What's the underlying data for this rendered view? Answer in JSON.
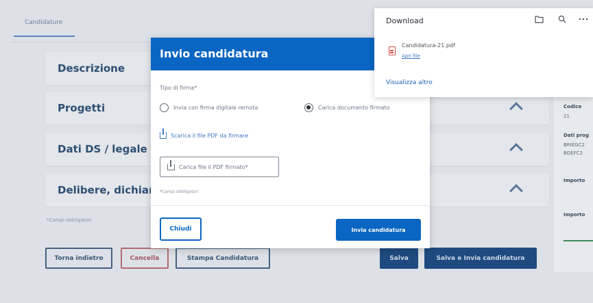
{
  "page": {
    "tab": "Candidature",
    "accordions": [
      {
        "title": "Descrizione"
      },
      {
        "title": "Progetti"
      },
      {
        "title": "Dati DS / legale"
      },
      {
        "title": "Delibere, dichiar"
      }
    ],
    "required_note": "*Campi obbligatori",
    "buttons": {
      "back": "Torna indietro",
      "cancel": "Cancella",
      "print": "Stampa Candidatura",
      "save": "Salva",
      "save_send": "Salva e Invia candidatura"
    }
  },
  "right_panel": {
    "code_label": "Codice",
    "code_value": "21",
    "data_label": "Dati prog",
    "data_value_1": "BRIEGC2",
    "data_value_2": "BGEFC2",
    "amount_label_1": "Importo",
    "amount_label_2": "Importo"
  },
  "modal": {
    "title": "Invio candidatura",
    "signature_label": "Tipo di firma*",
    "option_remote": "Invia con firma digitale remota",
    "option_upload": "Carica documento firmato",
    "download_link": "Scarica il file PDF da firmare",
    "upload_button": "Carica file il PDF firmato*",
    "required_note": "*Campi obbligatori",
    "close_button": "Chiudi",
    "submit_button": "Invia candidatura"
  },
  "downloads": {
    "title": "Download",
    "file_name": "Candidatura-21.pdf",
    "open_file": "Apri file",
    "show_more": "Visualizza altro"
  },
  "colors": {
    "primary": "#0a66c2",
    "dark_primary": "#1f4a80"
  }
}
